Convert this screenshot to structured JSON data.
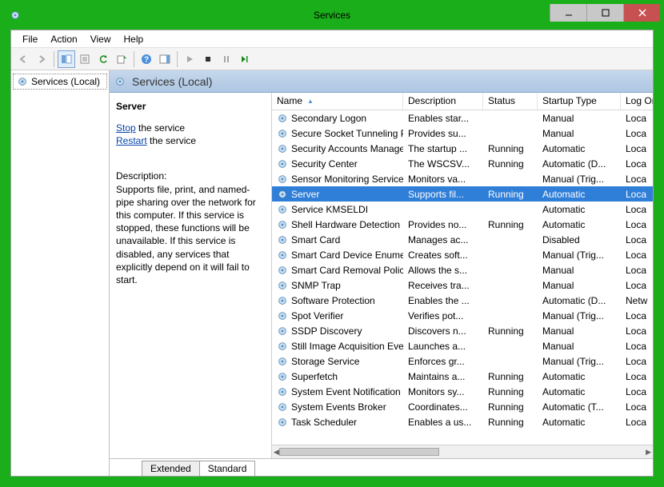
{
  "window": {
    "title": "Services"
  },
  "menus": [
    "File",
    "Action",
    "View",
    "Help"
  ],
  "tree": {
    "root": "Services (Local)"
  },
  "banner": {
    "title": "Services (Local)"
  },
  "detail": {
    "name": "Server",
    "stop_label": "Stop",
    "stop_suffix": " the service",
    "restart_label": "Restart",
    "restart_suffix": " the service",
    "desc_label": "Description:",
    "description": "Supports file, print, and named-pipe sharing over the network for this computer. If this service is stopped, these functions will be unavailable. If this service is disabled, any services that explicitly depend on it will fail to start."
  },
  "columns": {
    "name": "Name",
    "description": "Description",
    "status": "Status",
    "startup": "Startup Type",
    "logon": "Log On As"
  },
  "rows": [
    {
      "name": "Secondary Logon",
      "desc": "Enables star...",
      "status": "",
      "startup": "Manual",
      "log": "Loca"
    },
    {
      "name": "Secure Socket Tunneling Pr...",
      "desc": "Provides su...",
      "status": "",
      "startup": "Manual",
      "log": "Loca"
    },
    {
      "name": "Security Accounts Manager",
      "desc": "The startup ...",
      "status": "Running",
      "startup": "Automatic",
      "log": "Loca"
    },
    {
      "name": "Security Center",
      "desc": "The WSCSV...",
      "status": "Running",
      "startup": "Automatic (D...",
      "log": "Loca"
    },
    {
      "name": "Sensor Monitoring Service",
      "desc": "Monitors va...",
      "status": "",
      "startup": "Manual (Trig...",
      "log": "Loca"
    },
    {
      "name": "Server",
      "desc": "Supports fil...",
      "status": "Running",
      "startup": "Automatic",
      "log": "Loca",
      "selected": true
    },
    {
      "name": "Service KMSELDI",
      "desc": "",
      "status": "",
      "startup": "Automatic",
      "log": "Loca"
    },
    {
      "name": "Shell Hardware Detection",
      "desc": "Provides no...",
      "status": "Running",
      "startup": "Automatic",
      "log": "Loca"
    },
    {
      "name": "Smart Card",
      "desc": "Manages ac...",
      "status": "",
      "startup": "Disabled",
      "log": "Loca"
    },
    {
      "name": "Smart Card Device Enumera...",
      "desc": "Creates soft...",
      "status": "",
      "startup": "Manual (Trig...",
      "log": "Loca"
    },
    {
      "name": "Smart Card Removal Policy",
      "desc": "Allows the s...",
      "status": "",
      "startup": "Manual",
      "log": "Loca"
    },
    {
      "name": "SNMP Trap",
      "desc": "Receives tra...",
      "status": "",
      "startup": "Manual",
      "log": "Loca"
    },
    {
      "name": "Software Protection",
      "desc": "Enables the ...",
      "status": "",
      "startup": "Automatic (D...",
      "log": "Netw"
    },
    {
      "name": "Spot Verifier",
      "desc": "Verifies pot...",
      "status": "",
      "startup": "Manual (Trig...",
      "log": "Loca"
    },
    {
      "name": "SSDP Discovery",
      "desc": "Discovers n...",
      "status": "Running",
      "startup": "Manual",
      "log": "Loca"
    },
    {
      "name": "Still Image Acquisition Events",
      "desc": "Launches a...",
      "status": "",
      "startup": "Manual",
      "log": "Loca"
    },
    {
      "name": "Storage Service",
      "desc": "Enforces gr...",
      "status": "",
      "startup": "Manual (Trig...",
      "log": "Loca"
    },
    {
      "name": "Superfetch",
      "desc": "Maintains a...",
      "status": "Running",
      "startup": "Automatic",
      "log": "Loca"
    },
    {
      "name": "System Event Notification S...",
      "desc": "Monitors sy...",
      "status": "Running",
      "startup": "Automatic",
      "log": "Loca"
    },
    {
      "name": "System Events Broker",
      "desc": "Coordinates...",
      "status": "Running",
      "startup": "Automatic (T...",
      "log": "Loca"
    },
    {
      "name": "Task Scheduler",
      "desc": "Enables a us...",
      "status": "Running",
      "startup": "Automatic",
      "log": "Loca"
    }
  ],
  "tabs": {
    "extended": "Extended",
    "standard": "Standard"
  }
}
